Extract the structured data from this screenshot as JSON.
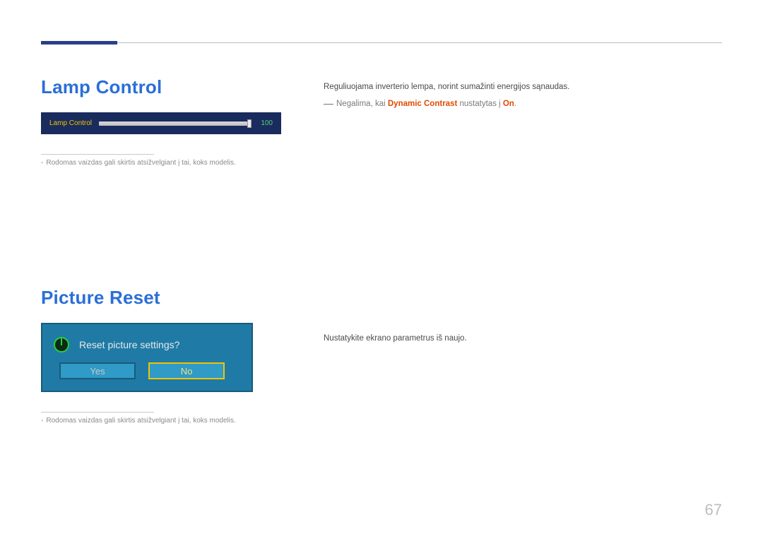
{
  "sections": {
    "lamp": {
      "title": "Lamp Control",
      "widget": {
        "label": "Lamp Control",
        "value": "100"
      },
      "footnote": "Rodomas vaizdas gali skirtis atsižvelgiant į tai, koks modelis.",
      "description": "Reguliuojama inverterio lempa, norint sumažinti energijos sąnaudas.",
      "warn_prefix": "Negalima, kai ",
      "warn_term": "Dynamic Contrast",
      "warn_mid": " nustatytas į ",
      "warn_val": "On",
      "warn_suffix": "."
    },
    "reset": {
      "title": "Picture Reset",
      "question": "Reset picture settings?",
      "yes": "Yes",
      "no": "No",
      "footnote": "Rodomas vaizdas gali skirtis atsižvelgiant į tai, koks modelis.",
      "description": "Nustatykite ekrano parametrus iš naujo."
    }
  },
  "page_number": "67"
}
